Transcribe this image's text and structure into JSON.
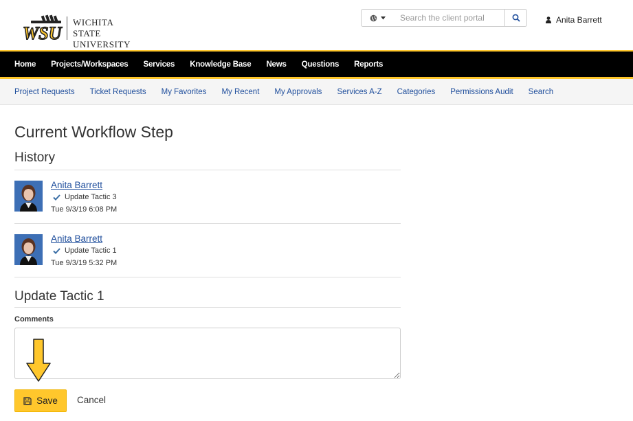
{
  "brand": {
    "line1": "Wichita State",
    "line2": "University",
    "mark": "WSU"
  },
  "header": {
    "search_placeholder": "Search the client portal",
    "user_name": "Anita Barrett"
  },
  "main_nav": [
    {
      "label": "Home"
    },
    {
      "label": "Projects/Workspaces"
    },
    {
      "label": "Services"
    },
    {
      "label": "Knowledge Base"
    },
    {
      "label": "News"
    },
    {
      "label": "Questions"
    },
    {
      "label": "Reports"
    }
  ],
  "sub_nav": [
    {
      "label": "Project Requests"
    },
    {
      "label": "Ticket Requests"
    },
    {
      "label": "My Favorites"
    },
    {
      "label": "My Recent"
    },
    {
      "label": "My Approvals"
    },
    {
      "label": "Services A-Z"
    },
    {
      "label": "Categories"
    },
    {
      "label": "Permissions Audit"
    },
    {
      "label": "Search"
    }
  ],
  "page": {
    "title": "Current Workflow Step",
    "history_title": "History",
    "history": [
      {
        "name": "Anita Barrett",
        "action": "Update Tactic 3",
        "time": "Tue 9/3/19 6:08 PM"
      },
      {
        "name": "Anita Barrett",
        "action": "Update Tactic 1",
        "time": "Tue 9/3/19 5:32 PM"
      }
    ],
    "step_title": "Update Tactic 1",
    "comments_label": "Comments",
    "comments_value": "",
    "save_label": "Save",
    "cancel_label": "Cancel"
  },
  "colors": {
    "accent": "#ffc72c",
    "nav_bg": "#000000",
    "link": "#1f4e9c"
  }
}
